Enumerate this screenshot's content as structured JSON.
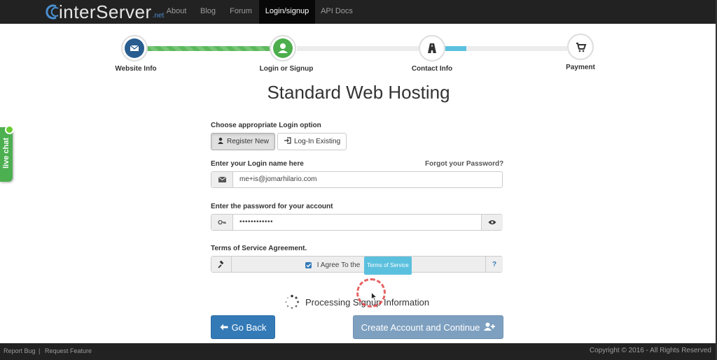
{
  "header": {
    "logo_text": "interServer",
    "logo_sub": ".net",
    "nav": [
      {
        "label": "About"
      },
      {
        "label": "Blog"
      },
      {
        "label": "Forum"
      },
      {
        "label": "Login/signup"
      },
      {
        "label": "API Docs"
      }
    ],
    "active_nav": "Login/signup"
  },
  "steps": [
    {
      "label": "Website Info",
      "icon": "envelope-icon",
      "state": "done"
    },
    {
      "label": "Login or Signup",
      "icon": "user-icon",
      "state": "current"
    },
    {
      "label": "Contact Info",
      "icon": "road-icon",
      "state": "pending"
    },
    {
      "label": "Payment",
      "icon": "cart-icon",
      "state": "pending"
    }
  ],
  "page": {
    "title": "Standard Web Hosting"
  },
  "form": {
    "login_option_label": "Choose appropriate Login option",
    "register_new": "Register New",
    "login_existing": "Log-In Existing",
    "selected_option": "Register New",
    "login_name_label": "Enter your Login name here",
    "forgot_password": "Forgot your Password?",
    "login_value": "me+is@jomarhilario.com",
    "password_label": "Enter the password for your account",
    "password_value": "••••••••••••",
    "tos_label": "Terms of Service Agreement.",
    "tos_agree_text": "I Agree To the",
    "tos_link": "Terms of Service",
    "tos_help": "?",
    "tos_checked": true
  },
  "status": {
    "processing_text": "Processing Signup Information"
  },
  "actions": {
    "back": "Go Back",
    "create": "Create Account and Continue"
  },
  "footer": {
    "report_bug": "Report Bug",
    "separator": "|",
    "request_feature": "Request Feature",
    "copyright": "Copyright © 2016 - All Rights Reserved"
  },
  "live_chat": {
    "label": "live chat"
  },
  "colors": {
    "nav_bg": "#222222",
    "primary": "#337ab7",
    "success": "#5cb85c",
    "info": "#5bc0de",
    "create_disabled": "#7ea0c0"
  }
}
